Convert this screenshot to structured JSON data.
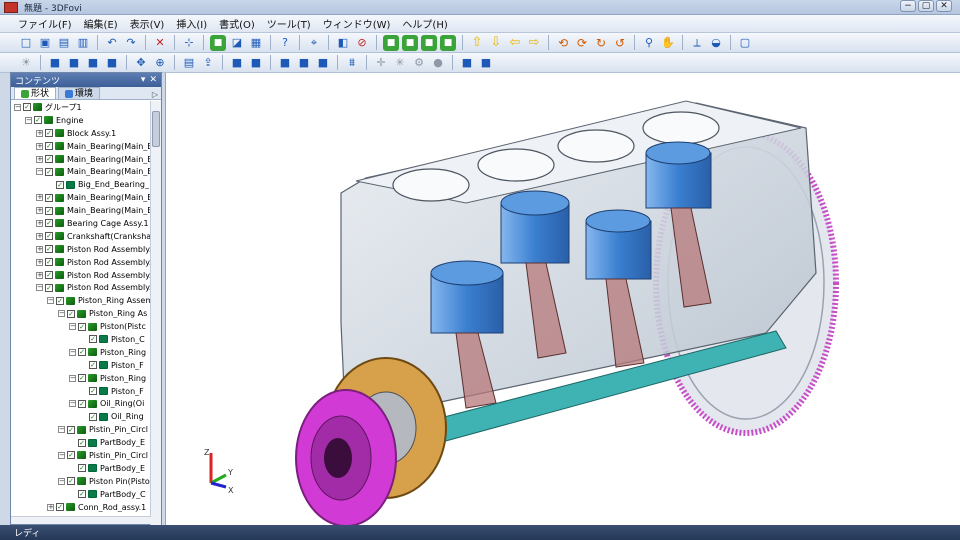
{
  "window": {
    "title": "無題 - 3DFovi",
    "controls": [
      "−",
      "▢",
      "✕"
    ]
  },
  "menu": [
    "ファイル(F)",
    "編集(E)",
    "表示(V)",
    "挿入(I)",
    "書式(O)",
    "ツール(T)",
    "ウィンドウ(W)",
    "ヘルプ(H)"
  ],
  "toolbar1": [
    "new-icon",
    "open-icon",
    "save-icon",
    "print-icon",
    "sep",
    "undo-icon",
    "redo-icon",
    "sep",
    "delete-icon",
    "sep",
    "select-icon",
    "sep",
    "green-cube-icon",
    "paint-icon",
    "screenshot-icon",
    "sep",
    "help-icon",
    "sep",
    "fit-view-icon",
    "sep",
    "hide-show-icon",
    "hide-icon",
    "sep",
    "green-box-a-icon",
    "green-box-b-icon",
    "green-box-c-icon",
    "green-box-d-icon",
    "sep",
    "arrow-up-icon",
    "arrow-down-icon",
    "arrow-left-icon",
    "arrow-right-icon",
    "sep",
    "rotate-a-icon",
    "rotate-b-icon",
    "rotate-c-icon",
    "rotate-d-icon",
    "sep",
    "zoom-icon",
    "pan-icon",
    "sep",
    "measure-icon",
    "section-icon",
    "sep",
    "fullscreen-icon"
  ],
  "toolbar2": [
    "light-icon",
    "sep",
    "layer-a-icon",
    "layer-b-icon",
    "layer-c-icon",
    "layer-d-icon",
    "sep",
    "move-icon",
    "magnify-icon",
    "sep",
    "align-icon",
    "export-icon",
    "sep",
    "grid-a-icon",
    "grid-b-icon",
    "sep",
    "tool-a-icon",
    "tool-b-icon",
    "tool-c-icon",
    "sep",
    "filter-icon",
    "sep",
    "move-cross-icon",
    "explode-icon",
    "gear-gray-icon",
    "sphere-icon",
    "sep",
    "view-a-icon",
    "view-b-icon"
  ],
  "panel": {
    "title": "コンテンツ",
    "controls": [
      "▾",
      "✕"
    ],
    "tabs": [
      {
        "label": "形状",
        "active": true
      },
      {
        "label": "環境",
        "active": false
      }
    ],
    "tab_arrow": "▷"
  },
  "tree": [
    {
      "label": "グループ1",
      "level": 0,
      "exp": "−",
      "kind": "group"
    },
    {
      "label": "Engine",
      "level": 1,
      "exp": "−",
      "kind": "group"
    },
    {
      "label": "Block Assy.1",
      "level": 2,
      "exp": "+",
      "kind": "group"
    },
    {
      "label": "Main_Bearing(Main_B",
      "level": 2,
      "exp": "+",
      "kind": "group"
    },
    {
      "label": "Main_Bearing(Main_B",
      "level": 2,
      "exp": "+",
      "kind": "group"
    },
    {
      "label": "Main_Bearing(Main_B",
      "level": 2,
      "exp": "−",
      "kind": "group"
    },
    {
      "label": "Big_End_Bearing_",
      "level": 3,
      "exp": "",
      "kind": "part"
    },
    {
      "label": "Main_Bearing(Main_B",
      "level": 2,
      "exp": "+",
      "kind": "group"
    },
    {
      "label": "Main_Bearing(Main_B",
      "level": 2,
      "exp": "+",
      "kind": "group"
    },
    {
      "label": "Bearing Cage Assy.1",
      "level": 2,
      "exp": "+",
      "kind": "group"
    },
    {
      "label": "Crankshaft(Crankshaf",
      "level": 2,
      "exp": "+",
      "kind": "group"
    },
    {
      "label": "Piston Rod Assembly.1",
      "level": 2,
      "exp": "+",
      "kind": "group"
    },
    {
      "label": "Piston Rod Assembly.2",
      "level": 2,
      "exp": "+",
      "kind": "group"
    },
    {
      "label": "Piston Rod Assembly.3",
      "level": 2,
      "exp": "+",
      "kind": "group"
    },
    {
      "label": "Piston Rod Assembly.4",
      "level": 2,
      "exp": "−",
      "kind": "group"
    },
    {
      "label": "Piston_Ring Assem",
      "level": 3,
      "exp": "−",
      "kind": "group"
    },
    {
      "label": "Piston_Ring As",
      "level": 4,
      "exp": "−",
      "kind": "group"
    },
    {
      "label": "Piston(Pistc",
      "level": 5,
      "exp": "−",
      "kind": "group"
    },
    {
      "label": "Piston_C",
      "level": 6,
      "exp": "",
      "kind": "part"
    },
    {
      "label": "Piston_Ring",
      "level": 5,
      "exp": "−",
      "kind": "group"
    },
    {
      "label": "Piston_F",
      "level": 6,
      "exp": "",
      "kind": "part"
    },
    {
      "label": "Piston_Ring",
      "level": 5,
      "exp": "−",
      "kind": "group"
    },
    {
      "label": "Piston_F",
      "level": 6,
      "exp": "",
      "kind": "part"
    },
    {
      "label": "Oil_Ring(Oi",
      "level": 5,
      "exp": "−",
      "kind": "group"
    },
    {
      "label": "Oil_Ring",
      "level": 6,
      "exp": "",
      "kind": "part"
    },
    {
      "label": "Pistin_Pin_Circl",
      "level": 4,
      "exp": "−",
      "kind": "group"
    },
    {
      "label": "PartBody_E",
      "level": 5,
      "exp": "",
      "kind": "part"
    },
    {
      "label": "Pistin_Pin_Circl",
      "level": 4,
      "exp": "−",
      "kind": "group"
    },
    {
      "label": "PartBody_E",
      "level": 5,
      "exp": "",
      "kind": "part"
    },
    {
      "label": "Piston Pin(Pisto",
      "level": 4,
      "exp": "−",
      "kind": "group"
    },
    {
      "label": "PartBody_C",
      "level": 5,
      "exp": "",
      "kind": "part"
    },
    {
      "label": "Conn_Rod_assy.1",
      "level": 3,
      "exp": "+",
      "kind": "group"
    },
    {
      "label": "",
      "level": 3,
      "exp": "+",
      "kind": "group"
    }
  ],
  "axes": {
    "z": "Z",
    "y": "Y",
    "x": "X"
  },
  "status": "レディ",
  "colors": {
    "block": "#c9d2dc",
    "piston": "#4c8ed8",
    "flywheel": "#c64fc8",
    "pulley": "#d23ad6",
    "base": "#3fb3b3",
    "rod": "#b7787a",
    "gear": "#d7a04a"
  }
}
